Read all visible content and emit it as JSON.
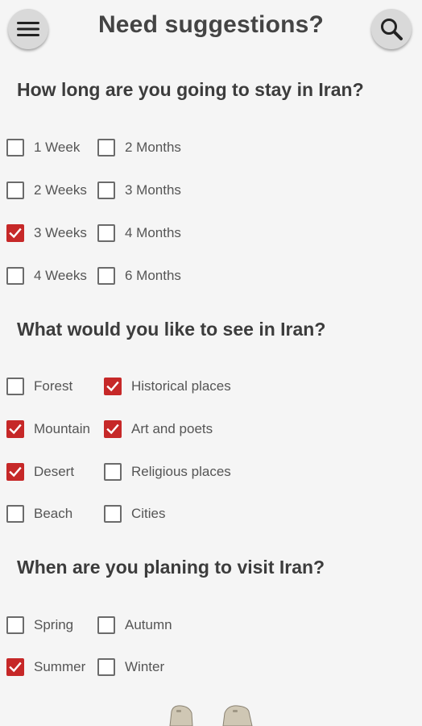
{
  "header": {
    "title": "Need suggestions?"
  },
  "sections": [
    {
      "question": "How long are you going to stay in Iran?",
      "options": [
        {
          "label": "1 Week",
          "checked": false
        },
        {
          "label": "2 Months",
          "checked": false
        },
        {
          "label": "2 Weeks",
          "checked": false
        },
        {
          "label": "3 Months",
          "checked": false
        },
        {
          "label": "3 Weeks",
          "checked": true
        },
        {
          "label": "4 Months",
          "checked": false
        },
        {
          "label": "4 Weeks",
          "checked": false
        },
        {
          "label": "6 Months",
          "checked": false
        }
      ]
    },
    {
      "question": "What would you like to see in Iran?",
      "options": [
        {
          "label": "Forest",
          "checked": false
        },
        {
          "label": "Historical places",
          "checked": true
        },
        {
          "label": "Mountain",
          "checked": true
        },
        {
          "label": "Art and poets",
          "checked": true
        },
        {
          "label": "Desert",
          "checked": true
        },
        {
          "label": "Religious places",
          "checked": false
        },
        {
          "label": "Beach",
          "checked": false
        },
        {
          "label": "Cities",
          "checked": false
        }
      ]
    },
    {
      "question": "When are you planing to visit Iran?",
      "options": [
        {
          "label": "Spring",
          "checked": false
        },
        {
          "label": "Autumn",
          "checked": false
        },
        {
          "label": "Summer",
          "checked": true
        },
        {
          "label": "Winter",
          "checked": false
        }
      ]
    }
  ],
  "icons": {
    "menu": "menu-icon",
    "search": "search-icon",
    "checkmark": "checkmark-icon"
  },
  "colors": {
    "accent": "#c62828",
    "background": "#f5f5f5",
    "button": "#d9d9d9"
  }
}
